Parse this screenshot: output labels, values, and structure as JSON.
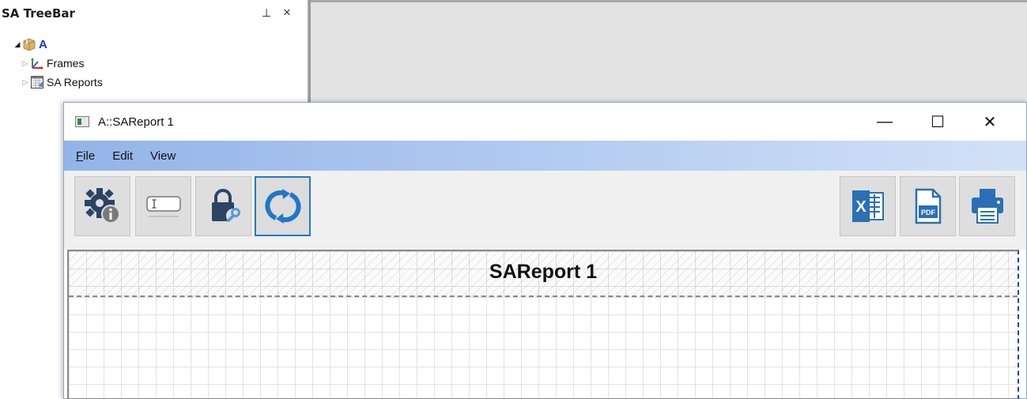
{
  "treebar": {
    "title": "SA TreeBar",
    "pin_glyph": "⊥",
    "close_glyph": "×",
    "root": {
      "label": "A",
      "icon": "box-icon"
    },
    "children": [
      {
        "label": "Frames",
        "icon": "axes-icon"
      },
      {
        "label": "SA Reports",
        "icon": "report-icon"
      }
    ]
  },
  "window": {
    "title": "A::SAReport 1",
    "minimize": "—",
    "maximize": "☐",
    "close": "✕"
  },
  "menu": {
    "file": {
      "first": "F",
      "rest": "ile"
    },
    "edit": "Edit",
    "view": "View"
  },
  "toolbar": {
    "left": [
      "settings-info-icon",
      "label-field-icon",
      "lock-key-icon",
      "refresh-icon"
    ],
    "right": [
      "excel-icon",
      "pdf-icon",
      "printer-icon"
    ],
    "active": "refresh-icon",
    "excel_letter": "X",
    "pdf_text": "PDF"
  },
  "report": {
    "title": "SAReport 1"
  },
  "colors": {
    "accent": "#1f78c8",
    "menubar": "#93b4e8",
    "title_blue": "#1a2ee6"
  }
}
